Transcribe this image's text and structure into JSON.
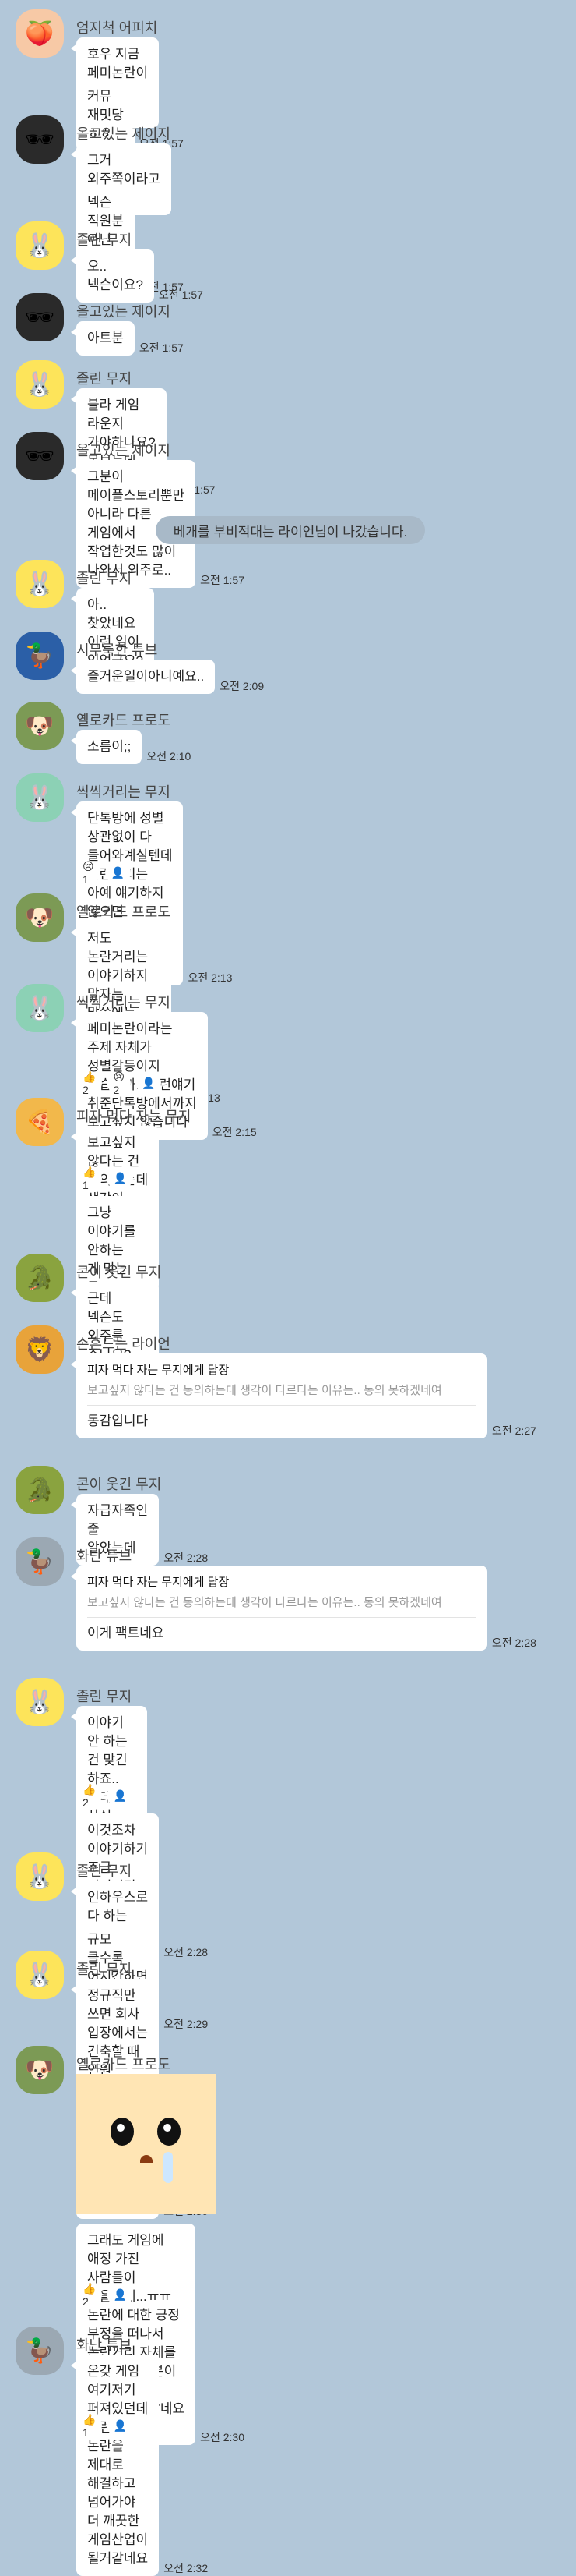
{
  "colors": {
    "background": "#b2c7d9",
    "bubble": "#ffffff",
    "unread": "#f2c300",
    "system_pill": "#a8b9c8"
  },
  "messages": [
    {
      "type": "msg",
      "name": "엄지척 어피치",
      "avatar": "peach",
      "lines": [
        {
          "text": "호우 지금 페미논란이 장난이 아니네요",
          "unread": "",
          "time": ""
        },
        {
          "text": "커뮤 재밋당 ㅎㅎ",
          "unread": "",
          "time": "오전 1:57"
        }
      ]
    },
    {
      "type": "msg",
      "name": "올고있는 제이지",
      "avatar": "jay",
      "lines": [
        {
          "text": "그거 외주쪽이라고 하던데",
          "unread": "",
          "time": ""
        },
        {
          "text": "넥슨 직원분 아닌 것 같아요",
          "unread": "",
          "time": "오전 1:57"
        }
      ]
    },
    {
      "type": "msg",
      "name": "졸린 무지",
      "avatar": "muzi",
      "lines": [
        {
          "text": "오.. 넥슨이요?",
          "unread": "",
          "time": "오전 1:57"
        }
      ]
    },
    {
      "type": "msg",
      "name": "올고있는 제이지",
      "avatar": "jay",
      "lines": [
        {
          "text": "아트분",
          "unread": "",
          "time": "오전 1:57"
        }
      ]
    },
    {
      "type": "msg",
      "name": "졸린 무지",
      "avatar": "muzi",
      "lines": [
        {
          "text": "블라 게임 라운지 가야하나요? 못보는데 ㅠㅠ",
          "unread": "",
          "time": "오전 1:57"
        }
      ]
    },
    {
      "type": "msg",
      "name": "올고있는 제이지",
      "avatar": "jay",
      "lines": [
        {
          "text": "그분이 메이플스토리뿐만 아니라 다른 게임에서 작업한것도 많이 나와서 외주로..",
          "unread": "",
          "time": "오전 1:57"
        }
      ]
    },
    {
      "type": "system",
      "text": "베개를 부비적대는 라이언님이 나갔습니다."
    },
    {
      "type": "msg",
      "name": "졸린 무지",
      "avatar": "muzi",
      "lines": [
        {
          "text": "아.. 찾았네요 이런 일이 있었군요?",
          "unread": "",
          "time": "오전 2:01"
        }
      ]
    },
    {
      "type": "msg",
      "name": "시무룩한 튜브",
      "avatar": "tube",
      "lines": [
        {
          "text": "즐거운일이아니예요..",
          "unread": "",
          "time": "오전 2:09"
        }
      ]
    },
    {
      "type": "msg",
      "name": "옐로카드 프로도",
      "avatar": "frodo",
      "lines": [
        {
          "text": "소름이;;",
          "unread": "",
          "time": "오전 2:10"
        }
      ]
    },
    {
      "type": "msg",
      "name": "씩씩거리는 무지",
      "avatar": "muzi2",
      "lines": [
        {
          "text": "단톡방에 성별 상관없이 다 들어와계실텐데 논란거리는 아예 얘기하지 않으면 안되는지요 각자 생각이 다 다를텐데요",
          "unread": "",
          "time": "오전 2:13"
        }
      ],
      "reacts": [
        "😢1",
        "👤"
      ]
    },
    {
      "type": "msg",
      "name": "옐로카드 프로도",
      "avatar": "frodo",
      "lines": [
        {
          "text": "저도 논란거리는 이야기하지 말자는 말씀에는 동의합니다만 죄송한데 성별이 무슨 상관인지요?",
          "unread": "",
          "time": "오전 2:13"
        }
      ]
    },
    {
      "type": "msg",
      "name": "씩씩거리는 무지",
      "avatar": "muzi2",
      "lines": [
        {
          "text": "페미논란이라는 주제 자체가 성별갈등이지 않습니까.. 이런얘기 취준단톡방에서까지 보고싶지 않습니다",
          "unread": "",
          "time": "오전 2:15"
        }
      ],
      "reacts": [
        "👍2",
        "😢2",
        "👤"
      ]
    },
    {
      "type": "msg",
      "name": "피자 먹다 자는 무지",
      "avatar": "pizza",
      "lines": [
        {
          "text": "보고싶지 않다는 건 동의하는데 생각이 다르다는 이유는.. 동의 못하겠네여",
          "unread": "",
          "time": ""
        }
      ],
      "reacts": [
        "👍1",
        "👤"
      ],
      "lines2": [
        {
          "text": "그냥 이야기를 안하는 게 맞는 듯 합니다 괜히 싸우니까~",
          "unread": "",
          "time": "오전 2:26"
        }
      ]
    },
    {
      "type": "msg",
      "name": "콘이 웃긴 무지",
      "avatar": "con",
      "lines": [
        {
          "text": "근데 넥슨도 외주를 주나요? 신기하네요",
          "unread": "",
          "time": "오전 2:27"
        }
      ]
    },
    {
      "type": "msg",
      "name": "손흔드는 라이언",
      "avatar": "ryan",
      "reply": {
        "head": "피자 먹다 자는 무지에게 답장",
        "quote": "보고싶지 않다는 건 동의하는데 생각이 다르다는 이유는.. 동의 못하겠네여",
        "text": "동감입니다"
      },
      "time": "오전 2:27"
    },
    {
      "type": "msg",
      "name": "콘이 웃긴 무지",
      "avatar": "con",
      "lines": [
        {
          "text": "자급자족인 줄 알았는데",
          "unread": "",
          "time": "오전 2:28"
        }
      ]
    },
    {
      "type": "msg",
      "name": "화난 튜브",
      "avatar": "angrytube",
      "reply": {
        "head": "피자 먹다 자는 무지에게 답장",
        "quote": "보고싶지 않다는 건 동의하는데 생각이 다르다는 이유는.. 동의 못하겠네여",
        "text": "이게 팩트네요"
      },
      "time": "오전 2:28"
    },
    {
      "type": "msg",
      "name": "졸린 무지",
      "avatar": "muzi",
      "lines": [
        {
          "text": "이야기 안 하는 건 맞긴 하죠.. 근데 사실 저도 생각이 다를 수 있다라는 점은 조금 이상한 게 결국 작게는 회사 크게는 업계에 피해를 끼치는 점에서는 안 좋게 보는 게 맞지 않을까 싶은..?",
          "unread": "",
          "time": ""
        }
      ],
      "reacts": [
        "👍2",
        "👤"
      ],
      "lines2": [
        {
          "text": "이것조차 이야기하기 조금 꺼려지긴 하는군요 불판 열릴까봐..",
          "unread": "",
          "time": "오전 2:28"
        }
      ]
    },
    {
      "type": "msg",
      "name": "졸린 무지",
      "avatar": "muzi",
      "lines": [
        {
          "text": "인하우스로 다 하는 회사가 드물어서 ㅋㅋ",
          "unread": "",
          "time": ""
        },
        {
          "text": "규모 클수록 어지간하면 외주 많이 주죠",
          "unread": "",
          "time": "오전 2:29"
        }
      ]
    },
    {
      "type": "msg",
      "name": "졸린 무지",
      "avatar": "muzi",
      "lines": [
        {
          "text": "정규직만 쓰면 회사 입장에서는 긴축할 때 인원 관리가 안되니까 유동적인 부분으로 계약, 외주 쓰는겁니다~",
          "unread": "",
          "time": "오전 2:30"
        }
      ]
    },
    {
      "type": "msg",
      "name": "옐로카드 프로도",
      "avatar": "frodo",
      "emoticon": true,
      "lines": [
        {
          "text": "그래도 게임에 애정 가진 사람들이 많을텐데...ㅠㅠ 논란에 대한 긍정 부정을 떠나서 논란거리 자체를 보기 힘드신분이 많을거라 말씀하신거같네요 ㅠ",
          "unread": "",
          "time": "오전 2:30"
        }
      ],
      "reacts": [
        "👍2",
        "👤"
      ]
    },
    {
      "type": "msg",
      "name": "화난 튜브",
      "avatar": "angrytube",
      "lines": [
        {
          "text": "온갖 게임 여기저기 퍼져있던데 이런 논란을 제대로 해결하고 넘어가야 더 깨끗한 게임산업이 될거같네요",
          "unread": "",
          "time": "오전 2:32"
        }
      ],
      "reacts": [
        "👍1",
        "👤"
      ]
    }
  ]
}
